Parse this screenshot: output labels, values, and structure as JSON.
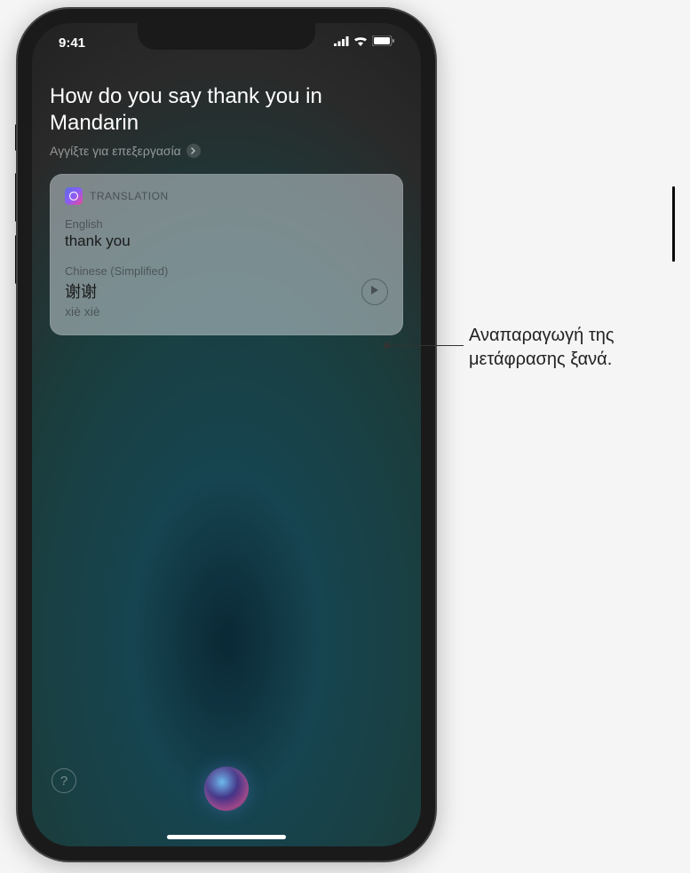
{
  "status": {
    "time": "9:41"
  },
  "query": {
    "text": "How do you say thank you in Mandarin",
    "tap_to_edit": "Αγγίξτε για επεξεργασία"
  },
  "card": {
    "title": "TRANSLATION",
    "source_lang": "English",
    "source_text": "thank you",
    "target_lang": "Chinese (Simplified)",
    "target_text": "谢谢",
    "romanization": "xiè xiè"
  },
  "callout": {
    "text": "Αναπαραγωγή της μετάφρασης ξανά."
  },
  "help": {
    "symbol": "?"
  }
}
